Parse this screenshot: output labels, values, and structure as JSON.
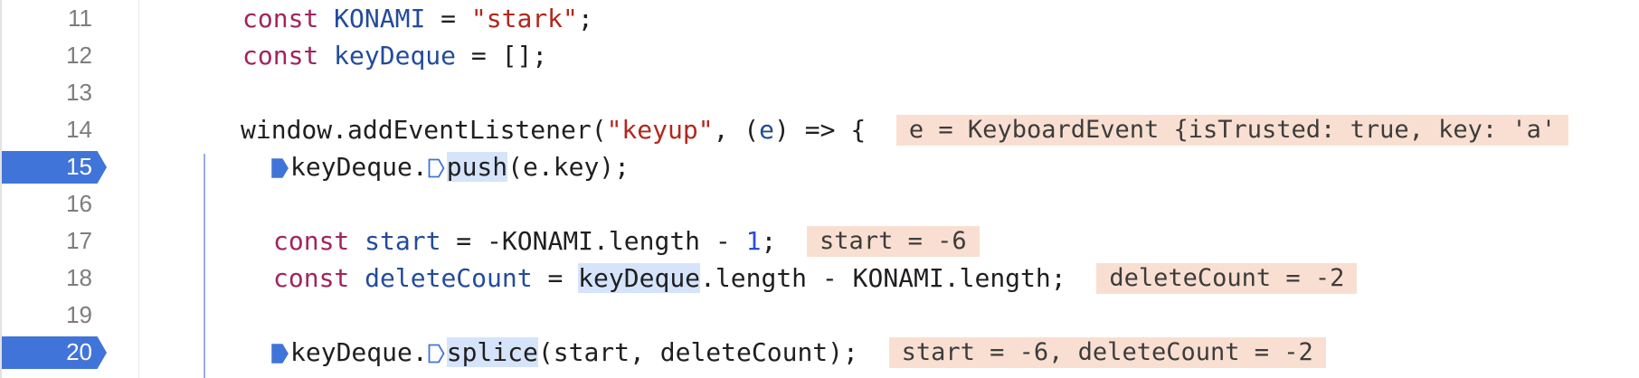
{
  "lines": [
    {
      "num": "11",
      "tokens": [
        "const",
        "KONAMI",
        " = ",
        "\"stark\"",
        ";"
      ]
    },
    {
      "num": "12",
      "tokens": [
        "const",
        "keyDeque",
        " = [];"
      ]
    },
    {
      "num": "13"
    },
    {
      "num": "14",
      "tokens": [
        "window.addEventListener(",
        "\"keyup\"",
        ", (",
        "e",
        ") => {"
      ],
      "inline": "e = KeyboardEvent {isTrusted: true, key: 'a'"
    },
    {
      "num": "15",
      "breakpoint": true,
      "tokens": [
        "keyDeque.",
        "push",
        "(e.key);"
      ]
    },
    {
      "num": "16"
    },
    {
      "num": "17",
      "tokens": [
        "const",
        "start",
        " = -KONAMI.length - ",
        "1",
        ";"
      ],
      "inline": "start = -6"
    },
    {
      "num": "18",
      "tokens": [
        "const",
        "deleteCount",
        " = ",
        "keyDeque",
        ".length - KONAMI.length;"
      ],
      "inline": "deleteCount = -2"
    },
    {
      "num": "19"
    },
    {
      "num": "20",
      "breakpoint": true,
      "tokens": [
        "keyDeque.",
        "splice",
        "(start, deleteCount);"
      ],
      "inline": "start = -6, deleteCount = -2"
    }
  ],
  "colors": {
    "breakpoint": "#4174d8",
    "inline_value_bg": "#f9dfd1",
    "keyword": "#a1245e",
    "identifier": "#234b9c",
    "string": "#b3271b",
    "selection": "#d6e4fb"
  },
  "icons": {
    "breakpoint_marker": "breakpoint-marker-icon",
    "column_breakpoint_active": "column-breakpoint-icon",
    "column_breakpoint_inactive": "column-breakpoint-hollow-icon"
  }
}
